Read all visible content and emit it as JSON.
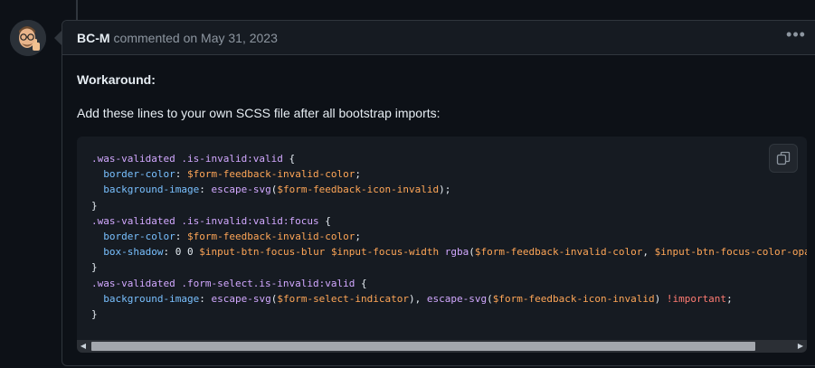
{
  "comment": {
    "author": "BC-M",
    "meta": "commented on May 31, 2023",
    "more_label": "•••"
  },
  "body": {
    "heading": "Workaround:",
    "instruction": "Add these lines to your own SCSS file after all bootstrap imports:"
  },
  "code": {
    "lines": [
      [
        {
          "t": "sel",
          "v": ".was-validated .is-invalid:valid"
        },
        {
          "t": "txt",
          "v": " {"
        }
      ],
      [
        {
          "t": "txt",
          "v": "  "
        },
        {
          "t": "prop",
          "v": "border-color"
        },
        {
          "t": "txt",
          "v": ": "
        },
        {
          "t": "var",
          "v": "$form-feedback-invalid-color"
        },
        {
          "t": "txt",
          "v": ";"
        }
      ],
      [
        {
          "t": "txt",
          "v": "  "
        },
        {
          "t": "prop",
          "v": "background-image"
        },
        {
          "t": "txt",
          "v": ": "
        },
        {
          "t": "fn",
          "v": "escape-svg"
        },
        {
          "t": "txt",
          "v": "("
        },
        {
          "t": "var",
          "v": "$form-feedback-icon-invalid"
        },
        {
          "t": "txt",
          "v": ");"
        }
      ],
      [
        {
          "t": "txt",
          "v": "}"
        }
      ],
      [
        {
          "t": "sel",
          "v": ".was-validated .is-invalid:valid:focus"
        },
        {
          "t": "txt",
          "v": " {"
        }
      ],
      [
        {
          "t": "txt",
          "v": "  "
        },
        {
          "t": "prop",
          "v": "border-color"
        },
        {
          "t": "txt",
          "v": ": "
        },
        {
          "t": "var",
          "v": "$form-feedback-invalid-color"
        },
        {
          "t": "txt",
          "v": ";"
        }
      ],
      [
        {
          "t": "txt",
          "v": "  "
        },
        {
          "t": "prop",
          "v": "box-shadow"
        },
        {
          "t": "txt",
          "v": ": 0 0 "
        },
        {
          "t": "var",
          "v": "$input-btn-focus-blur"
        },
        {
          "t": "txt",
          "v": " "
        },
        {
          "t": "var",
          "v": "$input-focus-width"
        },
        {
          "t": "txt",
          "v": " "
        },
        {
          "t": "fn",
          "v": "rgba"
        },
        {
          "t": "txt",
          "v": "("
        },
        {
          "t": "var",
          "v": "$form-feedback-invalid-color"
        },
        {
          "t": "txt",
          "v": ", "
        },
        {
          "t": "var",
          "v": "$input-btn-focus-color-opac"
        }
      ],
      [
        {
          "t": "txt",
          "v": "}"
        }
      ],
      [
        {
          "t": "sel",
          "v": ".was-validated .form-select.is-invalid:valid"
        },
        {
          "t": "txt",
          "v": " {"
        }
      ],
      [
        {
          "t": "txt",
          "v": "  "
        },
        {
          "t": "prop",
          "v": "background-image"
        },
        {
          "t": "txt",
          "v": ": "
        },
        {
          "t": "fn",
          "v": "escape-svg"
        },
        {
          "t": "txt",
          "v": "("
        },
        {
          "t": "var",
          "v": "$form-select-indicator"
        },
        {
          "t": "txt",
          "v": "), "
        },
        {
          "t": "fn",
          "v": "escape-svg"
        },
        {
          "t": "txt",
          "v": "("
        },
        {
          "t": "var",
          "v": "$form-feedback-icon-invalid"
        },
        {
          "t": "txt",
          "v": ") "
        },
        {
          "t": "imp",
          "v": "!important"
        },
        {
          "t": "txt",
          "v": ";"
        }
      ],
      [
        {
          "t": "txt",
          "v": "}"
        }
      ]
    ],
    "scroll_position": 0
  },
  "icons": {
    "avatar": "memoji-avatar",
    "copy": "copy-icon",
    "more": "kebab-horizontal-icon"
  },
  "colors": {
    "background": "#0d1117",
    "header": "#161b22",
    "border": "#30363d",
    "selector": "#d2a8ff",
    "property": "#79c0ff",
    "variable": "#ffa657",
    "important": "#ff7b72"
  }
}
